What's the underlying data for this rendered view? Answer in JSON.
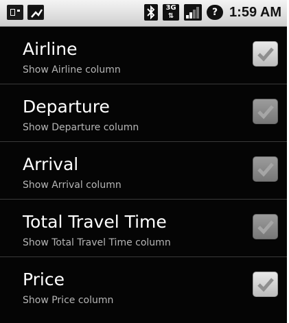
{
  "status_bar": {
    "time": "1:59 AM",
    "network_label": "3G",
    "icons": [
      "sd-card-icon",
      "usb-icon",
      "bluetooth-icon",
      "3g-icon",
      "signal-icon",
      "help-icon"
    ]
  },
  "preferences": [
    {
      "title": "Airline",
      "summary": "Show Airline column",
      "checked": true,
      "enabled": true
    },
    {
      "title": "Departure",
      "summary": "Show Departure column",
      "checked": true,
      "enabled": false
    },
    {
      "title": "Arrival",
      "summary": "Show Arrival column",
      "checked": true,
      "enabled": false
    },
    {
      "title": "Total Travel Time",
      "summary": "Show Total Travel Time column",
      "checked": true,
      "enabled": false
    },
    {
      "title": "Price",
      "summary": "Show Price column",
      "checked": true,
      "enabled": true
    }
  ]
}
